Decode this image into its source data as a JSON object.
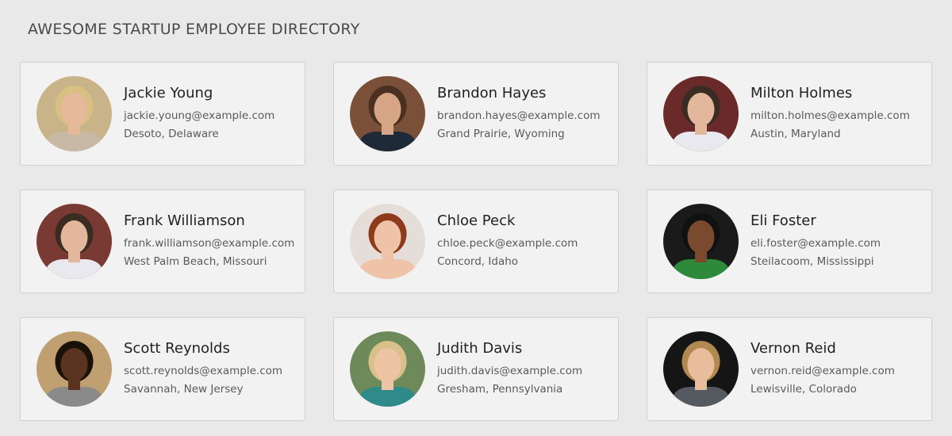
{
  "page": {
    "title": "AWESOME STARTUP EMPLOYEE DIRECTORY"
  },
  "employees": [
    {
      "name": "Jackie Young",
      "email": "jackie.young@example.com",
      "location": "Desoto, Delaware",
      "avatar": {
        "bg": "#c9b48a",
        "skin": "#e6b99a",
        "hair": "#d8bf82",
        "shirt": "#c8b9a6"
      }
    },
    {
      "name": "Brandon Hayes",
      "email": "brandon.hayes@example.com",
      "location": "Grand Prairie, Wyoming",
      "avatar": {
        "bg": "#7a5038",
        "skin": "#d5a585",
        "hair": "#4a3020",
        "shirt": "#1f2a38"
      }
    },
    {
      "name": "Milton Holmes",
      "email": "milton.holmes@example.com",
      "location": "Austin, Maryland",
      "avatar": {
        "bg": "#6a2a2a",
        "skin": "#e2b79c",
        "hair": "#3a2c22",
        "shirt": "#e8e8ee"
      }
    },
    {
      "name": "Frank Williamson",
      "email": "frank.williamson@example.com",
      "location": "West Palm Beach, Missouri",
      "avatar": {
        "bg": "#7a3a34",
        "skin": "#e2b79c",
        "hair": "#3a2c22",
        "shirt": "#e8e8ee"
      }
    },
    {
      "name": "Chloe Peck",
      "email": "chloe.peck@example.com",
      "location": "Concord, Idaho",
      "avatar": {
        "bg": "#e5ded8",
        "skin": "#efc3a8",
        "hair": "#8e3a1c",
        "shirt": "#efc3a8"
      }
    },
    {
      "name": "Eli Foster",
      "email": "eli.foster@example.com",
      "location": "Steilacoom, Mississippi",
      "avatar": {
        "bg": "#1a1a1a",
        "skin": "#7a4a2e",
        "hair": "#111111",
        "shirt": "#2d8a3a"
      }
    },
    {
      "name": "Scott Reynolds",
      "email": "scott.reynolds@example.com",
      "location": "Savannah, New Jersey",
      "avatar": {
        "bg": "#c0a070",
        "skin": "#5a3420",
        "hair": "#1a1208",
        "shirt": "#8a8a8a"
      }
    },
    {
      "name": "Judith Davis",
      "email": "judith.davis@example.com",
      "location": "Gresham, Pennsylvania",
      "avatar": {
        "bg": "#6f8a5a",
        "skin": "#edc4a4",
        "hair": "#d9c08a",
        "shirt": "#2f8a8a"
      }
    },
    {
      "name": "Vernon Reid",
      "email": "vernon.reid@example.com",
      "location": "Lewisville, Colorado",
      "avatar": {
        "bg": "#151515",
        "skin": "#e8bd9c",
        "hair": "#b08850",
        "shirt": "#555a60"
      }
    }
  ]
}
